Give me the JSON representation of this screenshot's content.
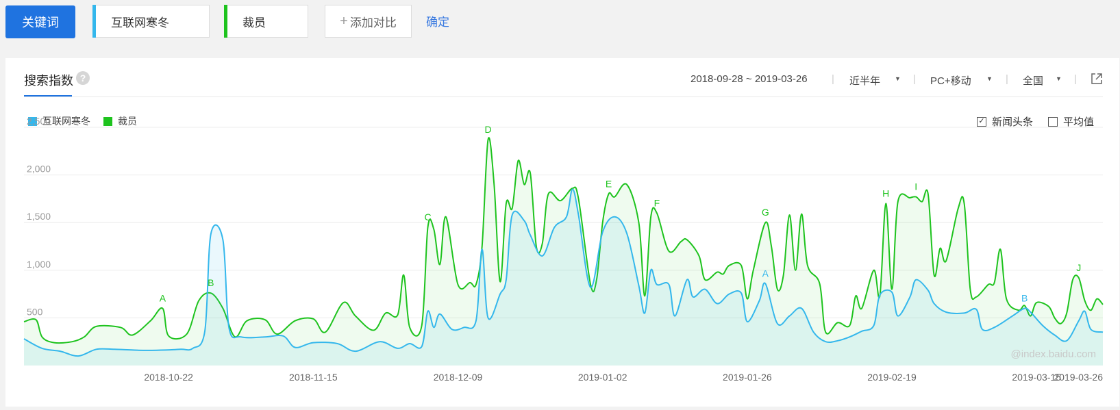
{
  "toolbar": {
    "keyword_label": "关键词",
    "terms": [
      {
        "label": "互联网寒冬",
        "color": "#34b7ec"
      },
      {
        "label": "裁员",
        "color": "#1ec31e"
      }
    ],
    "add_label": "添加对比",
    "confirm_label": "确定"
  },
  "card": {
    "title": "搜索指数",
    "help_icon": "?",
    "date_range": "2018-09-28 ~ 2019-03-26",
    "period": "近半年",
    "device": "PC+移动",
    "region": "全国",
    "export_icon": "external-link-icon"
  },
  "legend": {
    "items": [
      {
        "label": "互联网寒冬",
        "color": "#34b7ec"
      },
      {
        "label": "裁员",
        "color": "#1ec31e"
      }
    ],
    "news_label": "新闻头条",
    "news_checked": true,
    "average_label": "平均值",
    "average_checked": false
  },
  "watermark": "@index.baidu.com",
  "chart_data": {
    "type": "area",
    "y_ticks": [
      "2,500",
      "2,000",
      "1,500",
      "1,000",
      "500"
    ],
    "ylim": [
      0,
      2500
    ],
    "x_ticks": [
      "2018-10-22",
      "2018-11-15",
      "2018-12-09",
      "2019-01-02",
      "2019-01-26",
      "2019-02-19",
      "2019-03-15",
      "2019-03-26"
    ],
    "x_start": "2018-09-28",
    "x_end": "2019-03-26",
    "series": [
      {
        "name": "互联网寒冬",
        "color": "#34b7ec",
        "points": [
          [
            "2018-09-28",
            280
          ],
          [
            "2018-10-01",
            180
          ],
          [
            "2018-10-04",
            150
          ],
          [
            "2018-10-07",
            100
          ],
          [
            "2018-10-10",
            170
          ],
          [
            "2018-10-13",
            170
          ],
          [
            "2018-10-17",
            160
          ],
          [
            "2018-10-20",
            160
          ],
          [
            "2018-10-24",
            170
          ],
          [
            "2018-10-26",
            180
          ],
          [
            "2018-10-28",
            360
          ],
          [
            "2018-10-29",
            1380
          ],
          [
            "2018-10-31",
            1320
          ],
          [
            "2018-11-01",
            400
          ],
          [
            "2018-11-03",
            300
          ],
          [
            "2018-11-07",
            300
          ],
          [
            "2018-11-10",
            310
          ],
          [
            "2018-11-12",
            190
          ],
          [
            "2018-11-15",
            240
          ],
          [
            "2018-11-19",
            230
          ],
          [
            "2018-11-22",
            150
          ],
          [
            "2018-11-26",
            250
          ],
          [
            "2018-11-29",
            180
          ],
          [
            "2018-12-01",
            230
          ],
          [
            "2018-12-03",
            200
          ],
          [
            "2018-12-04",
            570
          ],
          [
            "2018-12-05",
            400
          ],
          [
            "2018-12-06",
            540
          ],
          [
            "2018-12-08",
            380
          ],
          [
            "2018-12-10",
            400
          ],
          [
            "2018-12-12",
            470
          ],
          [
            "2018-12-13",
            1220
          ],
          [
            "2018-12-14",
            500
          ],
          [
            "2018-12-16",
            750
          ],
          [
            "2018-12-17",
            900
          ],
          [
            "2018-12-18",
            1580
          ],
          [
            "2018-12-20",
            1520
          ],
          [
            "2018-12-21",
            1370
          ],
          [
            "2018-12-23",
            1150
          ],
          [
            "2018-12-25",
            1450
          ],
          [
            "2018-12-27",
            1560
          ],
          [
            "2018-12-28",
            1850
          ],
          [
            "2018-12-29",
            1580
          ],
          [
            "2018-12-31",
            820
          ],
          [
            "2019-01-02",
            1400
          ],
          [
            "2019-01-04",
            1560
          ],
          [
            "2019-01-06",
            1390
          ],
          [
            "2019-01-08",
            840
          ],
          [
            "2019-01-09",
            550
          ],
          [
            "2019-01-10",
            1000
          ],
          [
            "2019-01-11",
            850
          ],
          [
            "2019-01-13",
            850
          ],
          [
            "2019-01-14",
            520
          ],
          [
            "2019-01-16",
            900
          ],
          [
            "2019-01-17",
            720
          ],
          [
            "2019-01-19",
            800
          ],
          [
            "2019-01-21",
            650
          ],
          [
            "2019-01-23",
            750
          ],
          [
            "2019-01-25",
            760
          ],
          [
            "2019-01-26",
            460
          ],
          [
            "2019-01-28",
            680
          ],
          [
            "2019-01-29",
            860
          ],
          [
            "2019-01-31",
            440
          ],
          [
            "2019-02-02",
            520
          ],
          [
            "2019-02-04",
            600
          ],
          [
            "2019-02-06",
            350
          ],
          [
            "2019-02-08",
            250
          ],
          [
            "2019-02-10",
            260
          ],
          [
            "2019-02-12",
            300
          ],
          [
            "2019-02-14",
            360
          ],
          [
            "2019-02-16",
            420
          ],
          [
            "2019-02-17",
            740
          ],
          [
            "2019-02-19",
            770
          ],
          [
            "2019-02-20",
            520
          ],
          [
            "2019-02-22",
            720
          ],
          [
            "2019-02-23",
            900
          ],
          [
            "2019-02-25",
            790
          ],
          [
            "2019-02-26",
            650
          ],
          [
            "2019-02-28",
            560
          ],
          [
            "2019-03-03",
            550
          ],
          [
            "2019-03-05",
            590
          ],
          [
            "2019-03-06",
            380
          ],
          [
            "2019-03-08",
            400
          ],
          [
            "2019-03-11",
            520
          ],
          [
            "2019-03-13",
            600
          ],
          [
            "2019-03-14",
            560
          ],
          [
            "2019-03-16",
            420
          ],
          [
            "2019-03-18",
            320
          ],
          [
            "2019-03-20",
            260
          ],
          [
            "2019-03-22",
            470
          ],
          [
            "2019-03-23",
            570
          ],
          [
            "2019-03-24",
            380
          ],
          [
            "2019-03-26",
            350
          ]
        ]
      },
      {
        "name": "裁员",
        "color": "#1ec31e",
        "points": [
          [
            "2018-09-28",
            460
          ],
          [
            "2018-09-30",
            480
          ],
          [
            "2018-10-01",
            300
          ],
          [
            "2018-10-03",
            240
          ],
          [
            "2018-10-06",
            250
          ],
          [
            "2018-10-08",
            300
          ],
          [
            "2018-10-10",
            410
          ],
          [
            "2018-10-14",
            400
          ],
          [
            "2018-10-16",
            320
          ],
          [
            "2018-10-19",
            470
          ],
          [
            "2018-10-21",
            600
          ],
          [
            "2018-10-22",
            310
          ],
          [
            "2018-10-25",
            330
          ],
          [
            "2018-10-27",
            680
          ],
          [
            "2018-10-29",
            760
          ],
          [
            "2018-10-31",
            600
          ],
          [
            "2018-11-02",
            300
          ],
          [
            "2018-11-04",
            470
          ],
          [
            "2018-11-07",
            480
          ],
          [
            "2018-11-09",
            330
          ],
          [
            "2018-11-12",
            470
          ],
          [
            "2018-11-15",
            490
          ],
          [
            "2018-11-17",
            350
          ],
          [
            "2018-11-20",
            660
          ],
          [
            "2018-11-22",
            520
          ],
          [
            "2018-11-25",
            370
          ],
          [
            "2018-11-27",
            550
          ],
          [
            "2018-11-29",
            530
          ],
          [
            "2018-11-30",
            950
          ],
          [
            "2018-12-01",
            400
          ],
          [
            "2018-12-03",
            420
          ],
          [
            "2018-12-04",
            1450
          ],
          [
            "2018-12-05",
            1430
          ],
          [
            "2018-12-06",
            1060
          ],
          [
            "2018-12-07",
            1560
          ],
          [
            "2018-12-09",
            850
          ],
          [
            "2018-12-11",
            870
          ],
          [
            "2018-12-12",
            850
          ],
          [
            "2018-12-13",
            1250
          ],
          [
            "2018-12-14",
            2370
          ],
          [
            "2018-12-15",
            1900
          ],
          [
            "2018-12-16",
            880
          ],
          [
            "2018-12-17",
            1700
          ],
          [
            "2018-12-18",
            1650
          ],
          [
            "2018-12-19",
            2150
          ],
          [
            "2018-12-20",
            1900
          ],
          [
            "2018-12-21",
            2020
          ],
          [
            "2018-12-22",
            1250
          ],
          [
            "2018-12-23",
            1280
          ],
          [
            "2018-12-24",
            1800
          ],
          [
            "2018-12-26",
            1730
          ],
          [
            "2018-12-28",
            1860
          ],
          [
            "2018-12-29",
            1750
          ],
          [
            "2018-12-31",
            850
          ],
          [
            "2019-01-01",
            900
          ],
          [
            "2019-01-02",
            1500
          ],
          [
            "2019-01-03",
            1800
          ],
          [
            "2019-01-04",
            1770
          ],
          [
            "2019-01-06",
            1900
          ],
          [
            "2019-01-08",
            1500
          ],
          [
            "2019-01-09",
            730
          ],
          [
            "2019-01-10",
            1560
          ],
          [
            "2019-01-11",
            1600
          ],
          [
            "2019-01-13",
            1200
          ],
          [
            "2019-01-15",
            1300
          ],
          [
            "2019-01-16",
            1320
          ],
          [
            "2019-01-18",
            1150
          ],
          [
            "2019-01-19",
            900
          ],
          [
            "2019-01-21",
            980
          ],
          [
            "2019-01-22",
            960
          ],
          [
            "2019-01-23",
            1050
          ],
          [
            "2019-01-25",
            1050
          ],
          [
            "2019-01-26",
            700
          ],
          [
            "2019-01-27",
            1000
          ],
          [
            "2019-01-29",
            1500
          ],
          [
            "2019-01-30",
            1250
          ],
          [
            "2019-01-31",
            800
          ],
          [
            "2019-02-01",
            950
          ],
          [
            "2019-02-02",
            1580
          ],
          [
            "2019-02-03",
            1000
          ],
          [
            "2019-02-04",
            1590
          ],
          [
            "2019-02-05",
            1050
          ],
          [
            "2019-02-07",
            860
          ],
          [
            "2019-02-08",
            350
          ],
          [
            "2019-02-10",
            450
          ],
          [
            "2019-02-12",
            420
          ],
          [
            "2019-02-13",
            730
          ],
          [
            "2019-02-14",
            600
          ],
          [
            "2019-02-16",
            1000
          ],
          [
            "2019-02-17",
            730
          ],
          [
            "2019-02-18",
            1700
          ],
          [
            "2019-02-19",
            800
          ],
          [
            "2019-02-20",
            1720
          ],
          [
            "2019-02-22",
            1760
          ],
          [
            "2019-02-23",
            1770
          ],
          [
            "2019-02-24",
            1720
          ],
          [
            "2019-02-25",
            1800
          ],
          [
            "2019-02-26",
            950
          ],
          [
            "2019-02-27",
            1230
          ],
          [
            "2019-02-28",
            1100
          ],
          [
            "2019-03-02",
            1650
          ],
          [
            "2019-03-03",
            1700
          ],
          [
            "2019-03-04",
            800
          ],
          [
            "2019-03-05",
            720
          ],
          [
            "2019-03-07",
            850
          ],
          [
            "2019-03-08",
            870
          ],
          [
            "2019-03-09",
            1220
          ],
          [
            "2019-03-10",
            700
          ],
          [
            "2019-03-12",
            580
          ],
          [
            "2019-03-13",
            630
          ],
          [
            "2019-03-14",
            520
          ],
          [
            "2019-03-15",
            660
          ],
          [
            "2019-03-17",
            620
          ],
          [
            "2019-03-18",
            500
          ],
          [
            "2019-03-19",
            440
          ],
          [
            "2019-03-20",
            550
          ],
          [
            "2019-03-21",
            900
          ],
          [
            "2019-03-22",
            920
          ],
          [
            "2019-03-23",
            680
          ],
          [
            "2019-03-24",
            580
          ],
          [
            "2019-03-25",
            700
          ],
          [
            "2019-03-26",
            640
          ]
        ]
      }
    ],
    "annotations": [
      {
        "label": "A",
        "series": 1,
        "x": "2018-10-21",
        "y": 600
      },
      {
        "label": "B",
        "series": 1,
        "x": "2018-10-29",
        "y": 760
      },
      {
        "label": "C",
        "series": 1,
        "x": "2018-12-04",
        "y": 1450
      },
      {
        "label": "D",
        "series": 1,
        "x": "2018-12-14",
        "y": 2370
      },
      {
        "label": "E",
        "series": 1,
        "x": "2019-01-03",
        "y": 1800
      },
      {
        "label": "F",
        "series": 1,
        "x": "2019-01-11",
        "y": 1600
      },
      {
        "label": "G",
        "series": 1,
        "x": "2019-01-29",
        "y": 1500
      },
      {
        "label": "H",
        "series": 1,
        "x": "2019-02-18",
        "y": 1700
      },
      {
        "label": "I",
        "series": 1,
        "x": "2019-02-23",
        "y": 1770
      },
      {
        "label": "J",
        "series": 1,
        "x": "2019-03-22",
        "y": 920
      },
      {
        "label": "A",
        "series": 0,
        "x": "2019-01-29",
        "y": 860
      },
      {
        "label": "B",
        "series": 0,
        "x": "2019-03-13",
        "y": 600
      }
    ]
  }
}
